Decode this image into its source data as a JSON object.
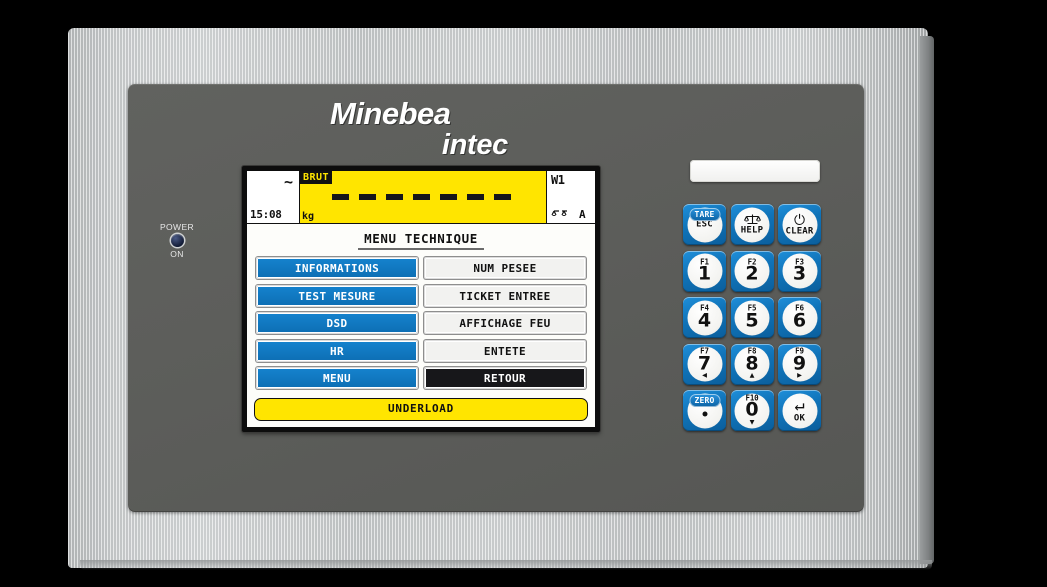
{
  "device": {
    "brand_line1": "Minebea",
    "brand_line2": "intec",
    "power_label_top": "POWER",
    "power_label_bottom": "ON",
    "power_led_color": "#1b2440",
    "bezel_color": "#c9cccd",
    "panel_color": "#5d5e5b"
  },
  "display": {
    "status_bar": {
      "ac_symbol": "~",
      "time": "15:08",
      "mode": "BRUT",
      "unit": "kg",
      "weight_dashes": [
        "-",
        "-",
        "-",
        "-",
        "-",
        "-",
        "-"
      ],
      "range_label": "W1",
      "scale_letter": "A",
      "weight_bg_color": "#ffe500"
    },
    "title": "MENU TECHNIQUE",
    "menu_left": [
      {
        "label": "INFORMATIONS",
        "state": "selected"
      },
      {
        "label": "TEST MESURE",
        "state": "selected"
      },
      {
        "label": "DSD",
        "state": "selected"
      },
      {
        "label": "HR",
        "state": "selected"
      },
      {
        "label": "MENU",
        "state": "selected"
      }
    ],
    "menu_right": [
      {
        "label": "NUM PESEE",
        "state": "plain"
      },
      {
        "label": "TICKET ENTREE",
        "state": "plain"
      },
      {
        "label": "AFFICHAGE FEU",
        "state": "plain"
      },
      {
        "label": "ENTETE",
        "state": "plain"
      },
      {
        "label": "RETOUR",
        "state": "dark"
      }
    ],
    "footer_status": "UNDERLOAD",
    "selected_color": "#1073b8",
    "footer_color": "#ffe500"
  },
  "label_strip": {
    "text": ""
  },
  "keypad": {
    "keys": [
      {
        "badge": "TARE",
        "sub": "ESC",
        "icon": "tare-icon"
      },
      {
        "glyph": "scale",
        "sub": "HELP",
        "icon": "scale-icon"
      },
      {
        "glyph": "power",
        "sub": "CLEAR",
        "icon": "power-icon"
      },
      {
        "fn": "F1",
        "num": "1"
      },
      {
        "fn": "F2",
        "num": "2"
      },
      {
        "fn": "F3",
        "num": "3"
      },
      {
        "fn": "F4",
        "num": "4"
      },
      {
        "fn": "F5",
        "num": "5"
      },
      {
        "fn": "F6",
        "num": "6"
      },
      {
        "fn": "F7",
        "num": "7",
        "arrow": "◀"
      },
      {
        "fn": "F8",
        "num": "8",
        "arrow": "▲"
      },
      {
        "fn": "F9",
        "num": "9",
        "arrow": "▶"
      },
      {
        "badge": "ZERO",
        "dot": true,
        "icon": "zero-icon"
      },
      {
        "fn": "F10",
        "num": "0",
        "arrow": "▼"
      },
      {
        "glyph": "enter",
        "sub": "OK",
        "icon": "enter-icon"
      }
    ],
    "key_color": "#1073b8"
  }
}
